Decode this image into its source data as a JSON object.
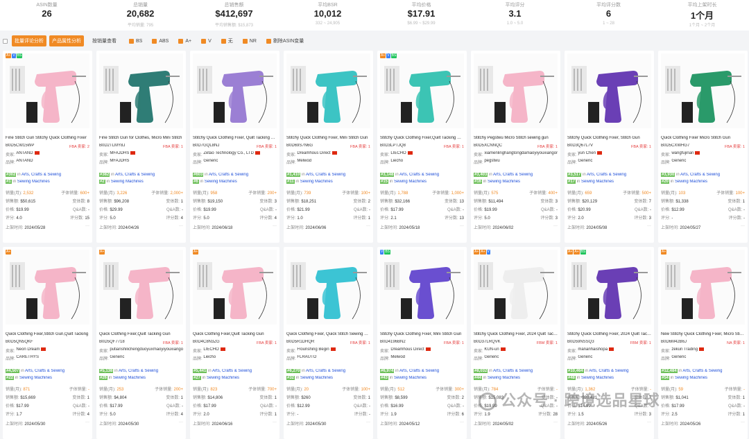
{
  "stats": [
    {
      "label": "ASIN数量",
      "value": "26",
      "sub": ""
    },
    {
      "label": "总销量",
      "value": "20,682",
      "sub": "平均销量: 795"
    },
    {
      "label": "总销售额",
      "value": "$412,697",
      "sub": "平均销售额: $15,873"
    },
    {
      "label": "平均BSR",
      "value": "10,012",
      "sub": "332 ~ 24,905"
    },
    {
      "label": "平均价格",
      "value": "$17.91",
      "sub": "$6.99 ~ $29.99"
    },
    {
      "label": "平均评分",
      "value": "3.1",
      "sub": "1.0 ~ 5.0"
    },
    {
      "label": "平均评分数",
      "value": "6",
      "sub": "1 ~ 28"
    },
    {
      "label": "平均上架时长",
      "value": "1个月",
      "sub": "1个月 ~ 2个月"
    }
  ],
  "filters": {
    "btn1": "批量评论分析",
    "btn2": "产品属性分析",
    "sort": "按销量查看",
    "items": [
      "BS",
      "ABS",
      "A+",
      "V",
      "无",
      "NR",
      "剔除ASIN变量"
    ]
  },
  "labels": {
    "seller": "卖家:",
    "brand": "品牌:",
    "sales": "销量(月):",
    "subsales": "子体销量:",
    "revenue": "销售额:",
    "variants": "变体数:",
    "price": "价格:",
    "qa": "Q&A数:",
    "rating": "评分:",
    "reviews": "评分数:",
    "listed": "上架时间:",
    "in": "in",
    "more": "···",
    "fba": "FBA",
    "sellers": "卖家: ",
    "cat": "Sewing Machines"
  },
  "cards": [
    {
      "badges": [
        "or",
        "bl",
        "gr"
      ],
      "title": "Fine Stitch Gun Stitchy Quick Clothing Fixer",
      "asin": "B0D5CW15WP",
      "fba": "FBA 卖家: 2",
      "seller": "ANTAND",
      "brand": "ANTAND",
      "rank1": "#302",
      "cat1": "Arts, Crafts & Sewing",
      "rank2": "#1",
      "sales": "2,532",
      "subsales": "600+",
      "revenue": "$50,615",
      "variants": "8",
      "price": "$19.99",
      "qa": "-",
      "rating": "4.0",
      "reviews": "15",
      "date": "2024/05/28",
      "color": "#f5b5c8"
    },
    {
      "badges": [],
      "title": "Fine Stitch Gun for Clothes, Micro Mini Stitch",
      "asin": "B0D2TLMY8J",
      "fba": "FBA 卖家: 1",
      "seller": "MFAJDHS",
      "brand": "MFAJDHS",
      "rank1": "#382",
      "cat1": "Arts, Crafts & Sewing",
      "rank2": "#2",
      "sales": "3,226",
      "subsales": "2,000+",
      "revenue": "$96,208",
      "variants": "1",
      "price": "$29.99",
      "qa": "-",
      "rating": "5.0",
      "reviews": "4",
      "date": "2024/04/26",
      "color": "#2f7d76"
    },
    {
      "badges": [],
      "title": "Stitchy Quick Clothing Fixer, Quilt Tacking Gun",
      "asin": "B0D7GQL8NJ",
      "fba": "FBA 卖家: 1",
      "seller": "Zetao Technology Co., LTD",
      "brand": "Generic",
      "rank1": "#603",
      "cat1": "Arts, Crafts & Sewing",
      "rank2": "#6",
      "sales": "958",
      "subsales": "200+",
      "revenue": "$19,150",
      "variants": "3",
      "price": "$19.99",
      "qa": "-",
      "rating": "5.0",
      "reviews": "4",
      "date": "2024/06/18",
      "color": "#9b7fd4"
    },
    {
      "badges": [],
      "title": "Stitchy Quick Clothing Fixer, Mini Stitch Gun",
      "asin": "B0D69S7N6G",
      "fba": "FBA 卖家: 1",
      "seller": "Dreamhous Direct",
      "brand": "Melwod",
      "rank1": "#1,410",
      "cat1": "Arts, Crafts & Sewing",
      "rank2": "#11",
      "sales": "739",
      "subsales": "100+",
      "revenue": "$18,251",
      "variants": "2",
      "price": "$21.99",
      "qa": "-",
      "rating": "1.0",
      "reviews": "1",
      "date": "2024/06/06",
      "color": "#3cc4c4"
    },
    {
      "badges": [
        "or",
        "bl",
        "gr"
      ],
      "title": "Stitchy Quick Clothing Fixer,Quilt Tacking Gun",
      "asin": "B0D3LPTJQ8",
      "fba": "FBA 卖家: 1",
      "seller": "LIECHO",
      "brand": "Liecho",
      "rank1": "#3,148",
      "cat1": "Arts, Crafts & Sewing",
      "rank2": "#15",
      "sales": "1,788",
      "subsales": "1,000+",
      "revenue": "$32,166",
      "variants": "13",
      "price": "$17.99",
      "qa": "-",
      "rating": "2.1",
      "reviews": "13",
      "date": "2024/05/18",
      "color": "#3cc4b4"
    },
    {
      "badges": [],
      "title": "Stitchy Pegstwu Micro Stitch sewing gun",
      "asin": "B0D5XCNNQC",
      "fba": "FBA 卖家: 1",
      "seller": "xiamenlinghangtongdamaoyiyouxiangongsi",
      "brand": "pegstwu",
      "rank1": "#3,403",
      "cat1": "Arts, Crafts & Sewing",
      "rank2": "#16",
      "sales": "575",
      "subsales": "400+",
      "revenue": "$11,494",
      "variants": "3",
      "price": "$19.99",
      "qa": "-",
      "rating": "5.0",
      "reviews": "3",
      "date": "2024/06/02",
      "color": "#f5b5c8"
    },
    {
      "badges": [],
      "title": "Stitchy Quick Clothing Fixer, Stitch Gun",
      "asin": "B0D3Q67L7V",
      "fba": "FBA 卖家: 1",
      "seller": "yun Chen",
      "brand": "Generic",
      "rank1": "#3,517",
      "cat1": "Arts, Crafts & Sewing",
      "rank2": "#17",
      "sales": "659",
      "subsales": "500+",
      "revenue": "$20,129",
      "variants": "7",
      "price": "$20.99",
      "qa": "-",
      "rating": "2.0",
      "reviews": "3",
      "date": "2024/05/08",
      "color": "#6a3fb5"
    },
    {
      "badges": [],
      "title": "Quick Clothing Fixer Micro Stitch Gun",
      "asin": "B0D5CXWHG7",
      "fba": "FBA 卖家: 1",
      "seller": "wangfujinan",
      "brand": "Generic",
      "rank1": "#3,930",
      "cat1": "Arts, Crafts & Sewing",
      "rank2": "#20",
      "sales": "103",
      "subsales": "100+",
      "revenue": "$1,338",
      "variants": "1",
      "price": "$12.99",
      "qa": "-",
      "rating": "-",
      "reviews": "-",
      "date": "2024/05/27",
      "color": "#2a9a6a"
    },
    {
      "badges": [
        "or"
      ],
      "title": "Quick Clothing Fixer,Stitch Gun,Quilt Tacking",
      "asin": "B0D5QN5QKF",
      "fba": "",
      "seller": "Neon Dream",
      "brand": "CARETHYS",
      "rank1": "#4,507",
      "cat1": "Arts, Crafts & Sewing",
      "rank2": "#22",
      "sales": "871",
      "subsales": "-",
      "revenue": "$15,669",
      "variants": "1",
      "price": "$17.99",
      "qa": "-",
      "rating": "1.7",
      "reviews": "4",
      "date": "2024/05/30",
      "color": "#f5b5c8"
    },
    {
      "badges": [
        "or"
      ],
      "title": "Quick Clothing Fixer,Quilt Tacking Gun",
      "asin": "B0D5QF7718",
      "fba": "FBA 卖家: 1",
      "seller": "putianshilichengduoyuxmaoyiyouxiangongsi",
      "brand": "Generic",
      "rank1": "#5,138",
      "cat1": "Arts, Crafts & Sewing",
      "rank2": "#26",
      "sales": "253",
      "subsales": "200+",
      "revenue": "$4,804",
      "variants": "1",
      "price": "$17.99",
      "qa": "-",
      "rating": "5.0",
      "reviews": "4",
      "date": "2024/05/30",
      "color": "#f5b5c8"
    },
    {
      "badges": [
        "or"
      ],
      "title": "Quick Clothing Fixer,Quilt Tacking Gun",
      "asin": "B0D4C8N3ZG",
      "fba": "FBA 卖家: 1",
      "seller": "LIECHO",
      "brand": "Liecho",
      "rank1": "#5,441",
      "cat1": "Arts, Crafts & Sewing",
      "rank2": "#27",
      "sales": "823",
      "subsales": "700+",
      "revenue": "$14,806",
      "variants": "1",
      "price": "$17.99",
      "qa": "-",
      "rating": "2.0",
      "reviews": "1",
      "date": "2024/06/16",
      "color": "#f5b5c8"
    },
    {
      "badges": [],
      "title": "Quick Clothing Fixer, Quick Stitch Sewing Gun",
      "asin": "B0D5R1DHQR",
      "fba": "FBA 卖家: 1",
      "seller": "Flourishing Begin",
      "brand": "FLRAUTO",
      "rank1": "#6,270",
      "cat1": "Arts, Crafts & Sewing",
      "rank2": "#32",
      "sales": "20",
      "subsales": "100+",
      "revenue": "$260",
      "variants": "1",
      "price": "$12.99",
      "qa": "-",
      "rating": "-",
      "reviews": "-",
      "date": "2024/05/30",
      "color": "#3cc4d4"
    },
    {
      "badges": [
        "bl",
        "gr"
      ],
      "title": "Stitchy Quick Clothing Fixer, Mini Stitch Gun",
      "asin": "B0D4196BN2",
      "fba": "FBA 卖家: 1",
      "seller": "Dreamhous Direct",
      "brand": "Melwod",
      "rank1": "#6,974",
      "cat1": "Arts, Crafts & Sewing",
      "rank2": "#43",
      "sales": "512",
      "subsales": "300+",
      "revenue": "$8,599",
      "variants": "2",
      "price": "$16.99",
      "qa": "-",
      "rating": "1.9",
      "reviews": "6",
      "date": "2024/05/12",
      "color": "#6a4fd0"
    },
    {
      "badges": [
        "or",
        "or",
        "bl"
      ],
      "title": "Stitchy Quick Clothing Fixer, 2024 Quilt Tacking",
      "asin": "B0D37LRQVK",
      "fba": "FBM 卖家: 1",
      "seller": "KUN-un",
      "brand": "Generic",
      "rank1": "#8,032",
      "cat1": "Arts, Crafts & Sewing",
      "rank2": "#44",
      "sales": "784",
      "subsales": "-",
      "revenue": "$15,083",
      "variants": "-",
      "price": "$19.99",
      "qa": "-",
      "rating": "1.9",
      "reviews": "28",
      "date": "2024/05/02",
      "color": "#eeeeee"
    },
    {
      "badges": [
        "or",
        "or",
        "gr"
      ],
      "title": "Stitchy Quick Clothing Fixer, 2024 Quilt Tacking",
      "asin": "B0D59NSSQ3",
      "fba": "FBM 卖家: 1",
      "seller": "mananhaishopa",
      "brand": "Generic",
      "rank1": "#10,464",
      "cat1": "Arts, Crafts & Sewing",
      "rank2": "#48",
      "sales": "1,362",
      "subsales": "-",
      "revenue": "$20,421",
      "variants": "7",
      "price": "$14.99",
      "qa": "-",
      "rating": "1.5",
      "reviews": "3",
      "date": "2024/05/26",
      "color": "#6a3fb5"
    },
    {
      "badges": [
        "or"
      ],
      "title": "New Stitchy Quick Clothing Fixer, Micro Stitch",
      "asin": "B0D6M42B6J",
      "fba": "NA 卖家: 1",
      "seller": "zekun Trading",
      "brand": "Generic",
      "rank1": "#12,484",
      "cat1": "Arts, Crafts & Sewing",
      "rank2": "#54",
      "sales": "59",
      "subsales": "-",
      "revenue": "$1,041",
      "variants": "1",
      "price": "$17.99",
      "qa": "-",
      "rating": "2.5",
      "reviews": "1",
      "date": "2024/05/26",
      "color": "#f5b5c8"
    }
  ],
  "watermark": "公众号 · 跨境选品星球"
}
